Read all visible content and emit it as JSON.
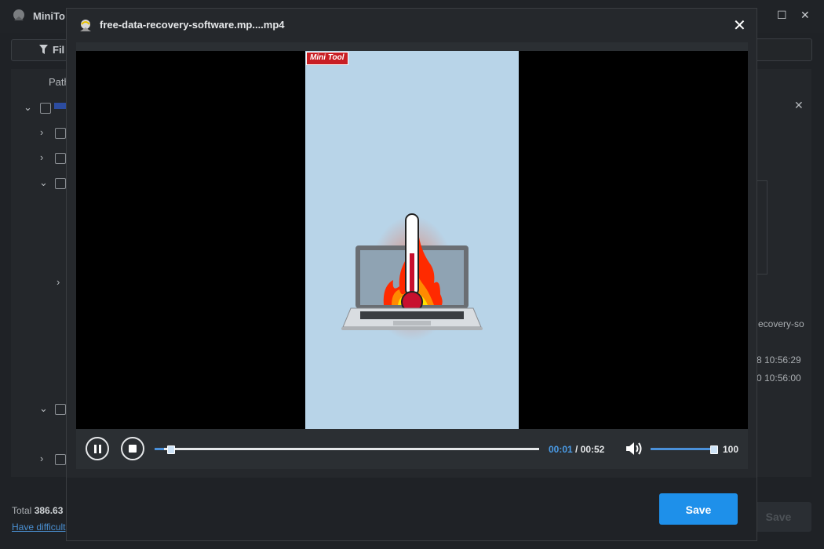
{
  "app": {
    "title": "MiniTo",
    "filter_label": "Fil",
    "column_path": "Path",
    "right_text_1": "ecovery-so",
    "right_text_2": "8 10:56:29",
    "right_text_3": "0 10:56:00",
    "total_label": "Total",
    "total_value": "386.63",
    "help_link": "Have difficult",
    "save_label": "Save"
  },
  "dialog": {
    "title": "free-data-recovery-software.mp....mp4",
    "watermark_part1": "Mini",
    "watermark_part2": "Tool",
    "player": {
      "current_time": "00:01",
      "total_time": "/ 00:52",
      "progress": 0.025,
      "volume": 100,
      "volume_label": "100"
    },
    "save_label": "Save"
  },
  "colors": {
    "accent": "#1e90ea",
    "time_accent": "#4a9be6",
    "watermark_red": "#c81e24",
    "frame_bg": "#b8d4e8"
  }
}
